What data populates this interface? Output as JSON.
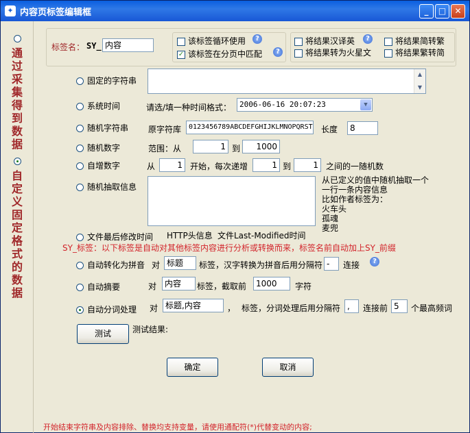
{
  "window": {
    "title": "内容页标签编辑框"
  },
  "left": {
    "option1": "通过采集得到数据",
    "option2": "自定义固定格式的数据"
  },
  "top": {
    "tag_name_label": "标签名：",
    "prefix": "SY_",
    "tag_name_value": "内容",
    "loop_use": "该标签循环使用",
    "match_in_pages": "该标签在分页中匹配",
    "translate_cn_en": "将结果汉译英",
    "simp_to_trad": "将结果简转繁",
    "to_mars": "将结果转为火星文",
    "trad_to_simp": "将结果繁转简"
  },
  "options": {
    "fixed_string": "固定的字符串",
    "system_time": "系统时间",
    "time_format_label": "请选/填一种时间格式：",
    "time_format_value": "2006-06-16 20:07:23",
    "random_string": "随机字符串",
    "source_chars_label": "原字符库",
    "source_chars_value": "0123456789ABCDEFGHIJKLMNOPQRSTUVWXYZ",
    "length_label": "长度",
    "length_value": "8",
    "random_number": "随机数字",
    "range_label": "范围：从",
    "range_from": "1",
    "range_to_label": "到",
    "range_to": "1000",
    "auto_increment": "自增数字",
    "inc_from_label": "从",
    "inc_from": "1",
    "inc_start_label": "开始，每次递增",
    "inc_step": "1",
    "inc_to_label": "到",
    "inc_to": "1",
    "inc_between_label": "之间的一随机数",
    "random_extract": "随机抽取信息",
    "random_extract_hint": [
      "从已定义的值中随机抽取一个",
      "一行一条内容信息",
      "比如作者标签为：",
      "火车头",
      "孤魂",
      "麦兜"
    ],
    "file_modified": "文件最后修改时间",
    "http_header": "HTTP头信息",
    "last_modified": "文件Last-Modified时间"
  },
  "sy_note": "SY_标签：以下标签是自动对其他标签内容进行分析或转换而来，标签名前自动加上SY_前缀",
  "auto": {
    "pinyin": "自动转化为拼音",
    "pinyin_for": "对",
    "pinyin_tag": "标题",
    "pinyin_desc": "标签，汉字转换为拼音后用分隔符",
    "pinyin_sep": "-",
    "pinyin_join": "连接",
    "summary": "自动摘要",
    "summary_for": "对",
    "summary_tag": "内容",
    "summary_desc": "标签，截取前",
    "summary_len": "1000",
    "summary_unit": "字符",
    "segment": "自动分词处理",
    "segment_for": "对",
    "segment_tags": "标题,内容",
    "segment_comma": "，",
    "segment_desc": "标签，分词处理后用分隔符",
    "segment_sep": ",",
    "segment_join": "连接前",
    "segment_count": "5",
    "segment_unit": "个最高频词"
  },
  "test": {
    "button": "测试",
    "result_label": "测试结果:"
  },
  "buttons": {
    "ok": "确定",
    "cancel": "取消"
  },
  "footer": "开始结束字符串及内容排除、替换均支持变量，请使用通配符(*)代替变动的内容;"
}
